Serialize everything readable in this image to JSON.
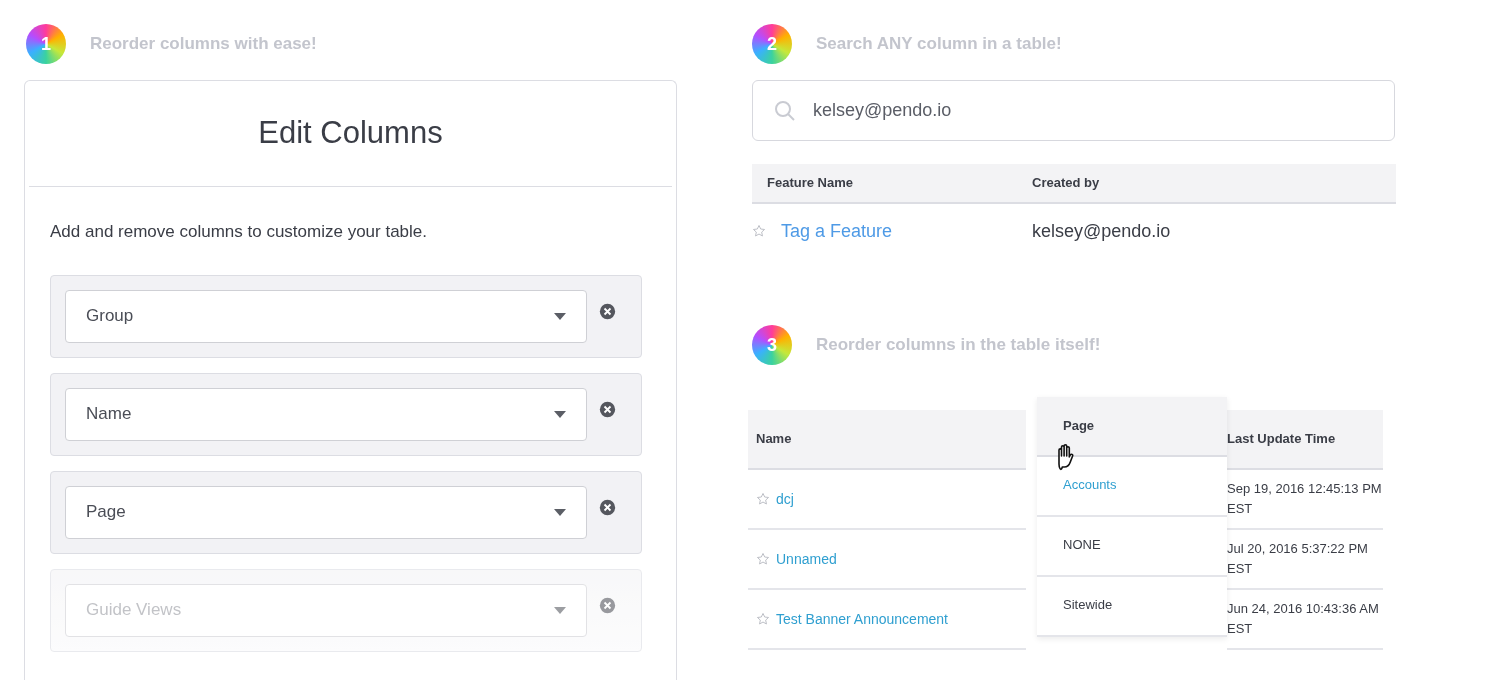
{
  "edit_columns": {
    "step": "1",
    "heading": "Reorder columns with ease!",
    "title": "Edit Columns",
    "description": "Add and remove columns to customize your table.",
    "columns": [
      {
        "label": "Group",
        "faded": false
      },
      {
        "label": "Name",
        "faded": false
      },
      {
        "label": "Page",
        "faded": false
      },
      {
        "label": "Guide Views",
        "faded": true
      }
    ]
  },
  "search": {
    "step": "2",
    "heading": "Search ANY column in a table!",
    "value": "kelsey@pendo.io",
    "columns": [
      "Feature Name",
      "Created by"
    ],
    "rows": [
      {
        "name": "Tag a Feature",
        "created_by": "kelsey@pendo.io"
      }
    ]
  },
  "reorder": {
    "step": "3",
    "heading": "Reorder columns in the table itself!",
    "columns": [
      {
        "label": "Name",
        "dragging": false
      },
      {
        "label": "Page",
        "dragging": true
      },
      {
        "label": "Last Update Time",
        "dragging": false
      }
    ],
    "rows": [
      {
        "name": "dcj",
        "page": "Accounts",
        "page_link": true,
        "updated": "Sep 19, 2016 12:45:13 PM EST"
      },
      {
        "name": "Unnamed",
        "page": "NONE",
        "page_link": false,
        "updated": "Jul 20, 2016 5:37:22 PM EST"
      },
      {
        "name": "Test Banner Announcement",
        "page": "Sitewide",
        "page_link": false,
        "updated": "Jun 24, 2016 10:43:36 AM EST"
      }
    ]
  }
}
